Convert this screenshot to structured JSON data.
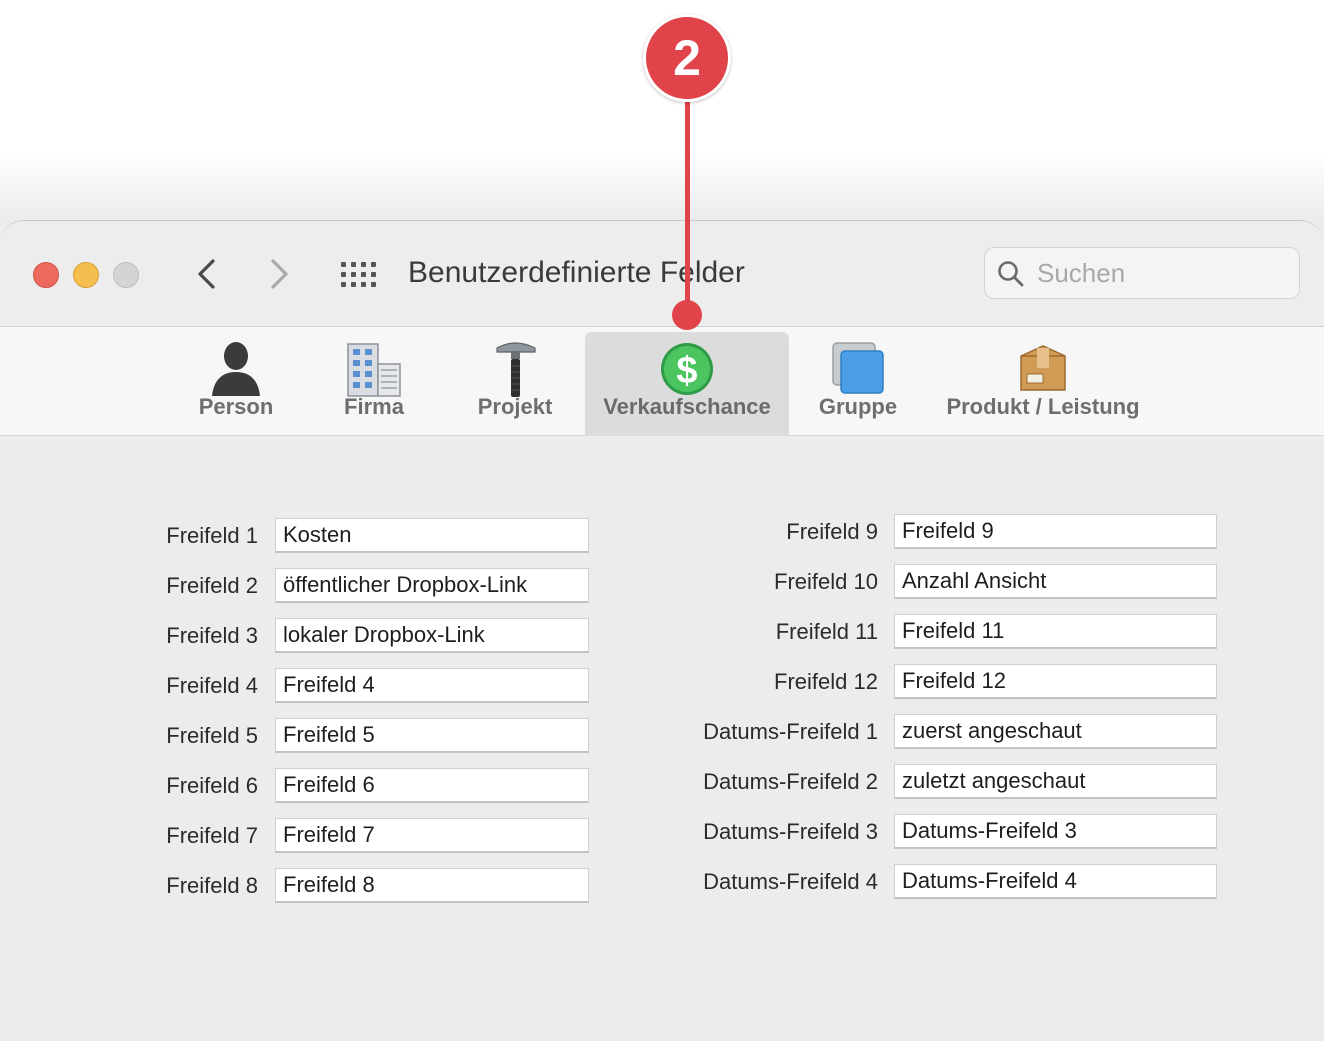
{
  "window": {
    "title": "Benutzerdefinierte Felder",
    "search_placeholder": "Suchen"
  },
  "tabs": [
    {
      "label": "Person",
      "icon": "person-icon"
    },
    {
      "label": "Firma",
      "icon": "building-icon"
    },
    {
      "label": "Projekt",
      "icon": "hammer-icon"
    },
    {
      "label": "Verkaufschance",
      "icon": "dollar-icon",
      "active": true
    },
    {
      "label": "Gruppe",
      "icon": "group-icon"
    },
    {
      "label": "Produkt / Leistung",
      "icon": "box-icon"
    }
  ],
  "fields_left": [
    {
      "label": "Freifeld 1",
      "value": "Kosten"
    },
    {
      "label": "Freifeld 2",
      "value": "öffentlicher Dropbox-Link"
    },
    {
      "label": "Freifeld 3",
      "value": "lokaler Dropbox-Link"
    },
    {
      "label": "Freifeld 4",
      "value": "Freifeld 4"
    },
    {
      "label": "Freifeld 5",
      "value": "Freifeld 5"
    },
    {
      "label": "Freifeld 6",
      "value": "Freifeld 6"
    },
    {
      "label": "Freifeld 7",
      "value": "Freifeld 7"
    },
    {
      "label": "Freifeld 8",
      "value": "Freifeld 8"
    }
  ],
  "fields_right": [
    {
      "label": "Freifeld 9",
      "value": "Freifeld 9"
    },
    {
      "label": "Freifeld 10",
      "value": "Anzahl Ansicht"
    },
    {
      "label": "Freifeld 11",
      "value": "Freifeld 11"
    },
    {
      "label": "Freifeld 12",
      "value": "Freifeld 12"
    },
    {
      "label": "Datums-Freifeld 1",
      "value": "zuerst angeschaut"
    },
    {
      "label": "Datums-Freifeld 2",
      "value": "zuletzt angeschaut"
    },
    {
      "label": "Datums-Freifeld 3",
      "value": "Datums-Freifeld 3"
    },
    {
      "label": "Datums-Freifeld 4",
      "value": "Datums-Freifeld 4"
    }
  ],
  "callout": {
    "number": "2"
  },
  "colors": {
    "accent_red": "#e0434a",
    "window_bg": "#ececec"
  }
}
